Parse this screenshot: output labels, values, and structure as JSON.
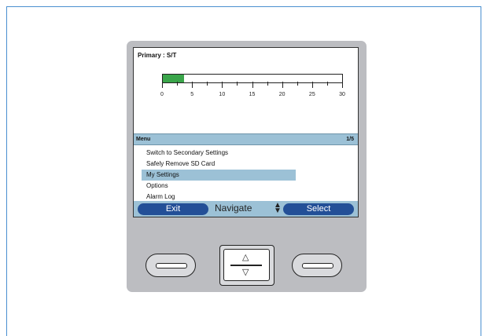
{
  "screen": {
    "top_label": "Primary : S/T",
    "meter": {
      "value": 3.5,
      "min": 0,
      "max": 30,
      "fill_color": "#3aa54a",
      "major_ticks": [
        "0",
        "5",
        "10",
        "15",
        "20",
        "25",
        "30"
      ]
    },
    "menu": {
      "title": "Menu",
      "page": "1/5",
      "selected_index": 2,
      "items": [
        "Switch to Secondary Settings",
        "Safely Remove SD Card",
        "My Settings",
        "Options",
        "Alarm Log"
      ]
    },
    "softbar": {
      "left_label": "Exit",
      "center_label": "Navigate",
      "right_label": "Select"
    }
  },
  "hardware_buttons": {
    "left": "left-softkey",
    "nav_up": "△",
    "nav_down": "▽",
    "right": "right-softkey"
  },
  "colors": {
    "header_bg": "#9cc1d6",
    "softkey_bg": "#234f97",
    "device_bg": "#bcbdc1"
  }
}
